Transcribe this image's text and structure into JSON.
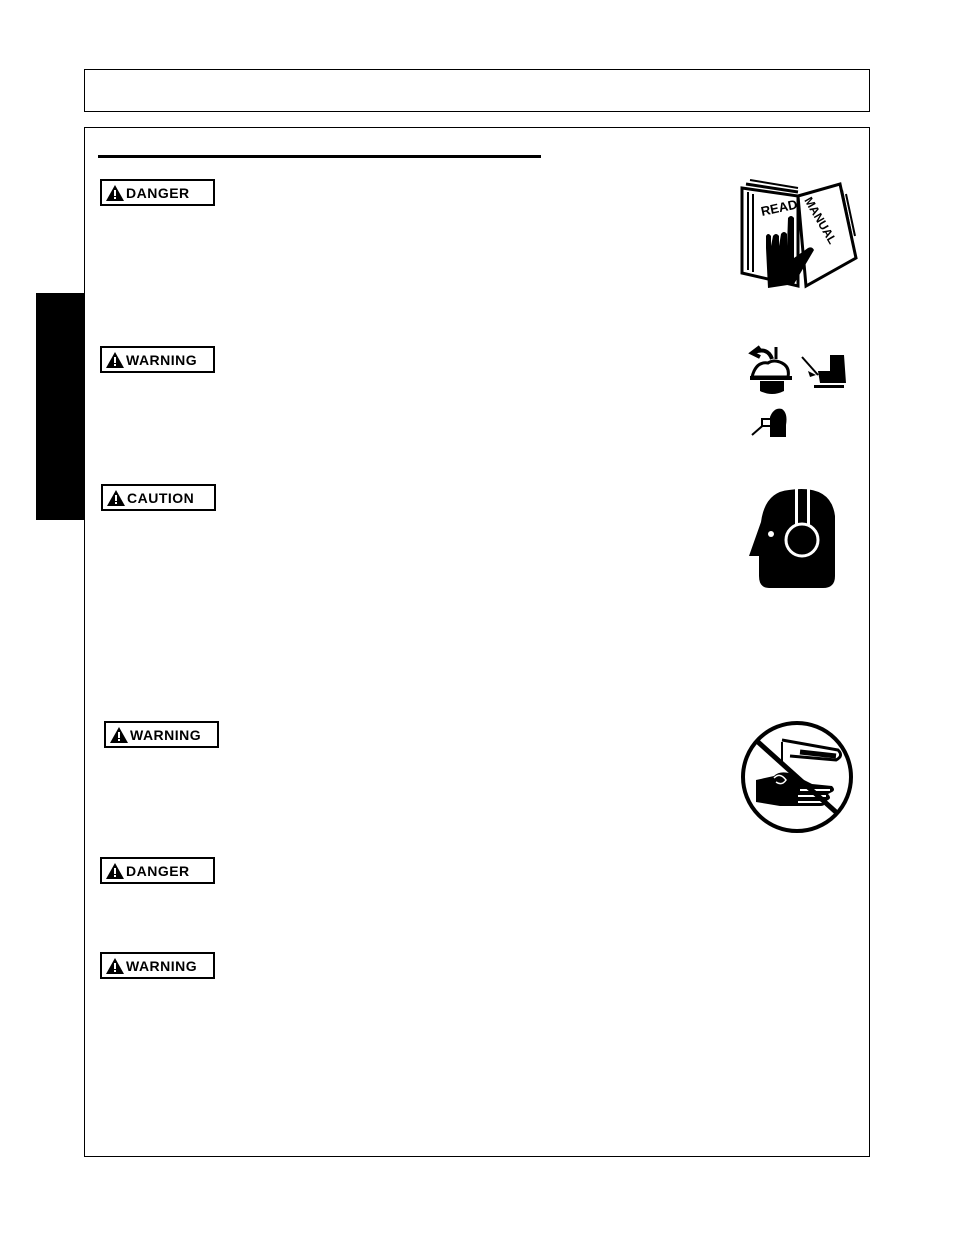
{
  "page": {
    "header_text": "",
    "section_title": "",
    "side_tab_text": ""
  },
  "labels": [
    {
      "signal_word": "DANGER",
      "icon": "alert-triangle-icon"
    },
    {
      "signal_word": "WARNING",
      "icon": "alert-triangle-icon"
    },
    {
      "signal_word": "CAUTION",
      "icon": "alert-triangle-icon"
    },
    {
      "signal_word": "WARNING",
      "icon": "alert-triangle-icon"
    },
    {
      "signal_word": "DANGER",
      "icon": "alert-triangle-icon"
    },
    {
      "signal_word": "WARNING",
      "icon": "alert-triangle-icon"
    }
  ],
  "pictograms": [
    {
      "name": "read-manual-icon",
      "text_left": "READ",
      "text_right": "MANUAL"
    },
    {
      "name": "protective-gear-icon"
    },
    {
      "name": "hearing-protection-icon"
    },
    {
      "name": "no-chemical-contact-icon"
    }
  ],
  "colors": {
    "ink": "#000000",
    "paper": "#ffffff"
  }
}
